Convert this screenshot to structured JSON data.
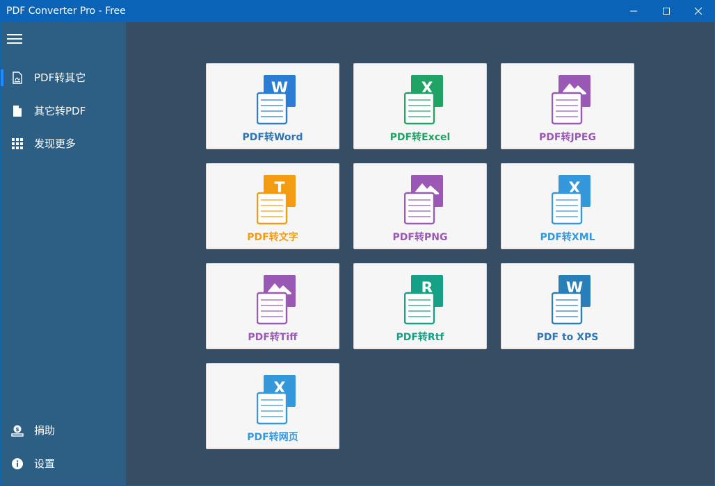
{
  "window": {
    "title": "PDF Converter Pro - Free"
  },
  "sidebar": {
    "items": [
      {
        "label": "PDF转其它",
        "icon": "pdf-file-icon",
        "active": true
      },
      {
        "label": "其它转PDF",
        "icon": "file-icon",
        "active": false
      },
      {
        "label": "发现更多",
        "icon": "grid-icon",
        "active": false
      }
    ],
    "bottom_items": [
      {
        "label": "捐助",
        "icon": "donate-icon"
      },
      {
        "label": "设置",
        "icon": "info-icon"
      }
    ]
  },
  "tiles": [
    {
      "label": "PDF转Word",
      "letter": "W",
      "color": "#2b7cd3",
      "label_color": "#2e75b6",
      "icon": "word-doc-icon"
    },
    {
      "label": "PDF转Excel",
      "letter": "X",
      "color": "#21a366",
      "label_color": "#21a366",
      "icon": "excel-doc-icon"
    },
    {
      "label": "PDF转JPEG",
      "letter": "",
      "color": "#9b59b6",
      "label_color": "#9b59b6",
      "icon": "image-doc-icon"
    },
    {
      "label": "PDF转文字",
      "letter": "T",
      "color": "#f39c12",
      "label_color": "#f39c12",
      "icon": "text-doc-icon"
    },
    {
      "label": "PDF转PNG",
      "letter": "",
      "color": "#9b59b6",
      "label_color": "#9b59b6",
      "icon": "image-doc-icon"
    },
    {
      "label": "PDF转XML",
      "letter": "X",
      "color": "#3498db",
      "label_color": "#3498db",
      "icon": "xml-doc-icon"
    },
    {
      "label": "PDF转Tiff",
      "letter": "",
      "color": "#9b59b6",
      "label_color": "#9b59b6",
      "icon": "image-doc-icon"
    },
    {
      "label": "PDF转Rtf",
      "letter": "R",
      "color": "#16a085",
      "label_color": "#16a085",
      "icon": "rtf-doc-icon"
    },
    {
      "label": "PDF to XPS",
      "letter": "W",
      "color": "#2980b9",
      "label_color": "#2e75b6",
      "icon": "xps-doc-icon"
    },
    {
      "label": "PDF转网页",
      "letter": "X",
      "color": "#3498db",
      "label_color": "#3498db",
      "icon": "html-doc-icon"
    }
  ],
  "colors": {
    "titlebar": "#0b63b8",
    "sidebar": "#2d5f85",
    "content": "#374d63",
    "accent": "#1a8cff"
  }
}
